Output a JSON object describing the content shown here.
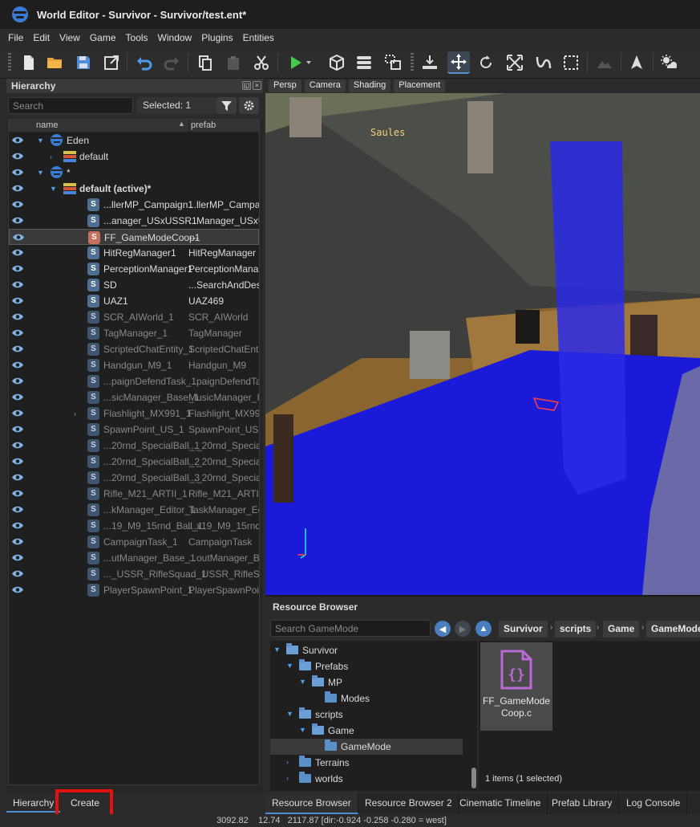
{
  "window": {
    "title": "World Editor - Survivor - Survivor/test.ent*"
  },
  "menu": [
    "File",
    "Edit",
    "View",
    "Game",
    "Tools",
    "Window",
    "Plugins",
    "Entities"
  ],
  "toolbar": {
    "buttons": [
      "new-file",
      "open-folder",
      "save",
      "export",
      "undo",
      "redo",
      "copy",
      "paste",
      "cut",
      "play",
      "cube",
      "stack",
      "transform-pivot",
      "snap-ground",
      "move",
      "rotate",
      "scale",
      "curve",
      "select-box",
      "terrain",
      "arrow-up",
      "weather"
    ],
    "active": "move"
  },
  "hierarchy": {
    "title": "Hierarchy",
    "search_placeholder": "Search",
    "selected_label": "Selected: 1",
    "columns": {
      "name": "name",
      "prefab": "prefab"
    },
    "rows": [
      {
        "indent": 0,
        "arrow": "▼",
        "icon": "globe",
        "name": "Eden",
        "prefab": "",
        "dim": false,
        "sel": false
      },
      {
        "indent": 1,
        "arrow": "›",
        "icon": "layer",
        "name": "default",
        "prefab": "",
        "dim": false,
        "sel": false
      },
      {
        "indent": 0,
        "arrow": "▼",
        "icon": "globe",
        "name": "*",
        "prefab": "",
        "dim": false,
        "sel": false
      },
      {
        "indent": 1,
        "arrow": "▼",
        "icon": "layer",
        "name": "default (active)*",
        "prefab": "",
        "dim": false,
        "sel": false,
        "bold": true
      },
      {
        "indent": 2,
        "arrow": "",
        "icon": "s",
        "name": "...llerMP_Campaign1",
        "prefab": "...llerMP_Campa",
        "dim": false,
        "sel": false
      },
      {
        "indent": 2,
        "arrow": "",
        "icon": "s",
        "name": "...anager_USxUSSR1",
        "prefab": "...Manager_USxU",
        "dim": false,
        "sel": false
      },
      {
        "indent": 2,
        "arrow": "",
        "icon": "s-red",
        "name": "FF_GameModeCoop1",
        "prefab": "---",
        "dim": false,
        "sel": true
      },
      {
        "indent": 2,
        "arrow": "",
        "icon": "s",
        "name": "HitRegManager1",
        "prefab": "HitRegManager",
        "dim": false,
        "sel": false
      },
      {
        "indent": 2,
        "arrow": "",
        "icon": "s",
        "name": "PerceptionManager1",
        "prefab": "PerceptionMana",
        "dim": false,
        "sel": false
      },
      {
        "indent": 2,
        "arrow": "",
        "icon": "s",
        "name": "SD",
        "prefab": "...SearchAndDest",
        "dim": false,
        "sel": false
      },
      {
        "indent": 2,
        "arrow": "",
        "icon": "s",
        "name": "UAZ1",
        "prefab": "UAZ469",
        "dim": false,
        "sel": false
      },
      {
        "indent": 2,
        "arrow": "",
        "icon": "s",
        "name": "SCR_AIWorld_1",
        "prefab": "SCR_AIWorld",
        "dim": true,
        "sel": false
      },
      {
        "indent": 2,
        "arrow": "",
        "icon": "s",
        "name": "TagManager_1",
        "prefab": "TagManager",
        "dim": true,
        "sel": false
      },
      {
        "indent": 2,
        "arrow": "",
        "icon": "s",
        "name": "ScriptedChatEntity_1",
        "prefab": "ScriptedChatEnt",
        "dim": true,
        "sel": false
      },
      {
        "indent": 2,
        "arrow": "",
        "icon": "s",
        "name": "Handgun_M9_1",
        "prefab": "Handgun_M9",
        "dim": true,
        "sel": false
      },
      {
        "indent": 2,
        "arrow": "",
        "icon": "s",
        "name": "...paignDefendTask_1",
        "prefab": "...paignDefendTa",
        "dim": true,
        "sel": false
      },
      {
        "indent": 2,
        "arrow": "",
        "icon": "s",
        "name": "...sicManager_Base_1",
        "prefab": "MusicManager_I",
        "dim": true,
        "sel": false
      },
      {
        "indent": 2,
        "arrow": "›",
        "icon": "s",
        "name": "Flashlight_MX991_1",
        "prefab": "Flashlight_MX99",
        "dim": true,
        "sel": false
      },
      {
        "indent": 2,
        "arrow": "",
        "icon": "s",
        "name": "SpawnPoint_US_1",
        "prefab": "SpawnPoint_US",
        "dim": true,
        "sel": false
      },
      {
        "indent": 2,
        "arrow": "",
        "icon": "s",
        "name": "...20rnd_SpecialBall_1",
        "prefab": "..._20rnd_Special",
        "dim": true,
        "sel": false
      },
      {
        "indent": 2,
        "arrow": "",
        "icon": "s",
        "name": "...20rnd_SpecialBall_2",
        "prefab": "..._20rnd_Special",
        "dim": true,
        "sel": false
      },
      {
        "indent": 2,
        "arrow": "",
        "icon": "s",
        "name": "...20rnd_SpecialBall_3",
        "prefab": "..._20rnd_Special",
        "dim": true,
        "sel": false
      },
      {
        "indent": 2,
        "arrow": "",
        "icon": "s",
        "name": "Rifle_M21_ARTII_1",
        "prefab": "Rifle_M21_ARTII",
        "dim": true,
        "sel": false
      },
      {
        "indent": 2,
        "arrow": "",
        "icon": "s",
        "name": "...kManager_Editor_1",
        "prefab": "TaskManager_Ed",
        "dim": true,
        "sel": false
      },
      {
        "indent": 2,
        "arrow": "",
        "icon": "s",
        "name": "...19_M9_15rnd_Ball_1",
        "prefab": "...x19_M9_15rnd_",
        "dim": true,
        "sel": false
      },
      {
        "indent": 2,
        "arrow": "",
        "icon": "s",
        "name": "CampaignTask_1",
        "prefab": "CampaignTask",
        "dim": true,
        "sel": false
      },
      {
        "indent": 2,
        "arrow": "",
        "icon": "s",
        "name": "...utManager_Base_1",
        "prefab": "...outManager_B",
        "dim": true,
        "sel": false
      },
      {
        "indent": 2,
        "arrow": "",
        "icon": "s",
        "name": "..._USSR_RifleSquad_1",
        "prefab": "..._USSR_RifleSqu",
        "dim": true,
        "sel": false
      },
      {
        "indent": 2,
        "arrow": "",
        "icon": "s",
        "name": "PlayerSpawnPoint_1",
        "prefab": "PlayerSpawnPoin",
        "dim": true,
        "sel": false
      }
    ],
    "tabs": {
      "hierarchy": "Hierarchy",
      "create": "Create"
    }
  },
  "viewport": {
    "tabs": [
      "Persp",
      "Camera",
      "Shading",
      "Placement"
    ],
    "label": "Saules"
  },
  "resource_browser": {
    "title": "Resource Browser",
    "search_placeholder": "Search GameMode",
    "breadcrumbs": [
      "Survivor",
      "scripts",
      "Game",
      "GameMode"
    ],
    "folders": [
      {
        "depth": 0,
        "arrow": "▼",
        "name": "Survivor",
        "open": true,
        "sel": false
      },
      {
        "depth": 1,
        "arrow": "▼",
        "name": "Prefabs",
        "open": true,
        "sel": false
      },
      {
        "depth": 2,
        "arrow": "▼",
        "name": "MP",
        "open": true,
        "sel": false
      },
      {
        "depth": 3,
        "arrow": "",
        "name": "Modes",
        "open": false,
        "sel": false
      },
      {
        "depth": 1,
        "arrow": "▼",
        "name": "scripts",
        "open": true,
        "sel": false
      },
      {
        "depth": 2,
        "arrow": "▼",
        "name": "Game",
        "open": true,
        "sel": false
      },
      {
        "depth": 3,
        "arrow": "",
        "name": "GameMode",
        "open": false,
        "sel": true
      },
      {
        "depth": 1,
        "arrow": "›",
        "name": "Terrains",
        "open": false,
        "sel": false
      },
      {
        "depth": 1,
        "arrow": "›",
        "name": "worlds",
        "open": false,
        "sel": false
      }
    ],
    "asset": {
      "line1": "FF_GameMode",
      "line2": "Coop.c"
    },
    "item_count": "1 items (1 selected)"
  },
  "bottom_tabs": [
    "Resource Browser",
    "Resource Browser 2",
    "Cinematic Timeline",
    "Prefab Library",
    "Log Console"
  ],
  "status": "3092.82    12.74   2117.87 [dir:-0.924 -0.258 -0.280 = west]",
  "colors": {
    "accent": "#4a8fd6",
    "highlight": "#e3120f",
    "script_icon": "#4e6f91",
    "volume_blue": "#1a1ad8"
  }
}
